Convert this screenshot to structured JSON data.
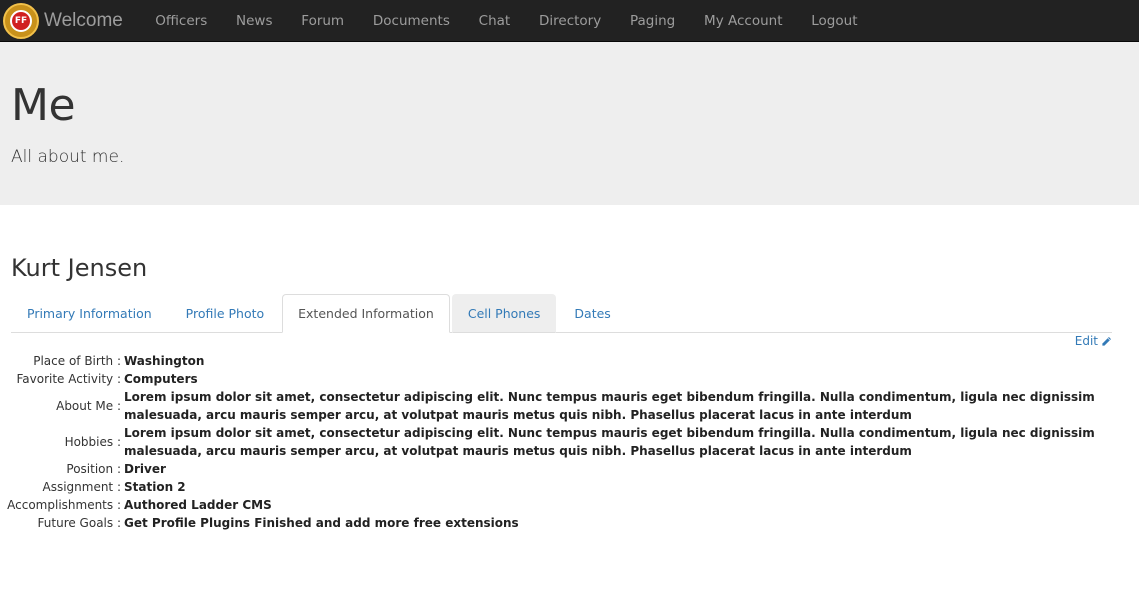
{
  "navbar": {
    "brand": "Welcome",
    "logo_text": "FF",
    "links": [
      "Officers",
      "News",
      "Forum",
      "Documents",
      "Chat",
      "Directory",
      "Paging",
      "My Account",
      "Logout"
    ]
  },
  "jumbotron": {
    "title": "Me",
    "subtitle": "All about me."
  },
  "profile": {
    "name": "Kurt Jensen",
    "tabs": [
      {
        "label": "Primary Information"
      },
      {
        "label": "Profile Photo"
      },
      {
        "label": "Extended Information"
      },
      {
        "label": "Cell Phones"
      },
      {
        "label": "Dates"
      }
    ],
    "active_tab": "Extended Information",
    "edit_label": "Edit",
    "fields": [
      {
        "label": "Place of Birth :",
        "value": "Washington"
      },
      {
        "label": "Favorite Activity :",
        "value": "Computers"
      },
      {
        "label": "About Me :",
        "value": "Lorem ipsum dolor sit amet, consectetur adipiscing elit. Nunc tempus mauris eget bibendum fringilla. Nulla condimentum, ligula nec dignissim malesuada, arcu mauris semper arcu, at volutpat mauris metus quis nibh. Phasellus placerat lacus in ante interdum"
      },
      {
        "label": "Hobbies :",
        "value": "Lorem ipsum dolor sit amet, consectetur adipiscing elit. Nunc tempus mauris eget bibendum fringilla. Nulla condimentum, ligula nec dignissim malesuada, arcu mauris semper arcu, at volutpat mauris metus quis nibh. Phasellus placerat lacus in ante interdum"
      },
      {
        "label": "Position :",
        "value": "Driver"
      },
      {
        "label": "Assignment :",
        "value": "Station 2"
      },
      {
        "label": "Accomplishments :",
        "value": "Authored Ladder CMS"
      },
      {
        "label": "Future Goals :",
        "value": "Get Profile Plugins Finished and add more free extensions"
      }
    ]
  },
  "colors": {
    "navbar_bg": "#222222",
    "nav_text": "#9d9d9d",
    "jumbotron_bg": "#eeeeee",
    "link": "#337ab7"
  },
  "icons": {
    "edit": "pencil-icon",
    "logo": "fire-department-logo"
  }
}
